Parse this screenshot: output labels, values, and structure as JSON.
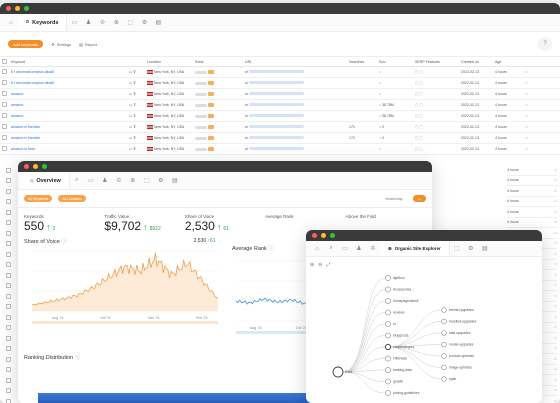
{
  "keywords_window": {
    "tab_active": "Keywords",
    "project_lines": [
      "",
      ""
    ],
    "toolbar": {
      "add_keywords": "Add keywords",
      "settings": "Settings",
      "report": "Report"
    },
    "columns": [
      "Keyword",
      "Location",
      "Rank",
      "URL",
      "Searches",
      "SoV",
      "SERP Features",
      "Created on",
      "Age"
    ],
    "rows": [
      {
        "keyword": "8 f cincinnati oneplus alkal8",
        "location": "New York, NY, USA",
        "searches": "",
        "sov": "",
        "created": "2022-02-13",
        "age": "4 hours"
      },
      {
        "keyword": "8 f cincinnati oneplus alkal8",
        "location": "New York, NY, USA",
        "searches": "",
        "sov": "",
        "created": "2022-02-13",
        "age": "4 hours"
      },
      {
        "keyword": "amazon",
        "location": "New York, NY, USA",
        "searches": "",
        "sov": "",
        "created": "2022-02-13",
        "age": "4 hours"
      },
      {
        "keyword": "amazon",
        "location": "New York, NY, USA",
        "searches": "",
        "sov": "38.78M",
        "created": "2022-02-13",
        "age": "4 hours"
      },
      {
        "keyword": "amazon",
        "location": "New York, NY, USA",
        "searches": "",
        "sov": "38.78M",
        "created": "2022-02-13",
        "age": "4 hours"
      },
      {
        "keyword": "amazon in firestick",
        "location": "New York, NY, USA",
        "searches": "170",
        "sov": "0",
        "created": "2022-02-13",
        "age": "4 hours"
      },
      {
        "keyword": "amazon in firestick",
        "location": "New York, NY, USA",
        "searches": "170",
        "sov": "0",
        "created": "2022-02-13",
        "age": "4 hours"
      },
      {
        "keyword": "amazon in best",
        "location": "New York, NY, USA",
        "searches": "",
        "sov": "",
        "created": "2022-02-13",
        "age": "4 hours"
      }
    ],
    "side_ages": [
      "4 hours",
      "4 hours",
      "4 hours",
      "4 hours",
      "4 hours",
      "4 hours",
      "4 hours",
      "4 hours",
      "4 hours",
      "4 hours",
      "4 hours",
      "4 hours",
      "4 hours",
      "4 hours",
      "4 hours",
      "4 hours",
      "4 hours",
      "4 hours",
      "4 hours",
      "4 hours",
      "4 hours",
      "4 hours",
      "4 hours",
      "4 hours"
    ]
  },
  "overview_window": {
    "tab_active": "Overview",
    "filters": [
      "All Keywords",
      "All Locations"
    ],
    "date_text": "Yesterday",
    "metrics": [
      {
        "label": "Keywords",
        "value": "550",
        "delta": "0",
        "delta_dir": "up"
      },
      {
        "label": "Traffic Value",
        "value": "$9,702",
        "delta": "$922",
        "delta_dir": "up"
      },
      {
        "label": "Share of Voice",
        "value": "2,530",
        "delta": "61",
        "delta_dir": "up"
      },
      {
        "label": "Average Rank",
        "value": "",
        "delta": "",
        "delta_dir": ""
      },
      {
        "label": "Above the Fold",
        "value": "",
        "delta": "",
        "delta_dir": ""
      }
    ],
    "sov_title": "Share of Voice",
    "sov_value": "2,530",
    "sov_delta": "61",
    "avg_rank_title": "Average Rank",
    "ranking_title": "Ranking Distribution",
    "x_ticks": [
      "Aug '21",
      "Oct '21",
      "Dec '21",
      "Feb '22"
    ],
    "avg_x_ticks": [
      "Aug '21",
      "Oct '21",
      "Dec '21",
      "Feb '22"
    ]
  },
  "site_explorer_window": {
    "tab_active": "Organic Site Explorer",
    "root_node": "Root",
    "nodes": [
      "lightbox",
      "Accessories",
      "homepage/about",
      "reviews",
      "el",
      "blog/posts",
      "shop/category",
      "Offerwise",
      "ranking-data",
      "growth",
      "pricing-guidelines"
    ],
    "leaf_nodes": [
      "theme-upgrades",
      "handled-upgrades",
      "sale-upgrades",
      "model-upgrades",
      "product-optimize",
      "image-optimize",
      "splat"
    ]
  },
  "colors": {
    "accent_orange": "#f38c2b",
    "link_blue": "#2f6fd1",
    "positive_green": "#2ea34b",
    "chart_line": "#f0a04b",
    "rank_line": "#4a90d9"
  },
  "chart_data": [
    {
      "type": "area",
      "title": "Share of Voice",
      "x": [
        "Aug '21",
        "Oct '21",
        "Dec '21",
        "Feb '22"
      ],
      "series": [
        {
          "values": [
            30,
            45,
            60,
            80,
            120,
            170,
            220,
            200,
            260,
            180,
            240,
            150,
            60
          ]
        }
      ]
    },
    {
      "type": "line",
      "title": "Average Rank",
      "x": [
        "Aug '21",
        "Oct '21",
        "Dec '21",
        "Feb '22"
      ],
      "series": [
        {
          "values": [
            40,
            42,
            38,
            41,
            39,
            43,
            40,
            38,
            42,
            39,
            41,
            44,
            40,
            30
          ]
        }
      ]
    }
  ]
}
